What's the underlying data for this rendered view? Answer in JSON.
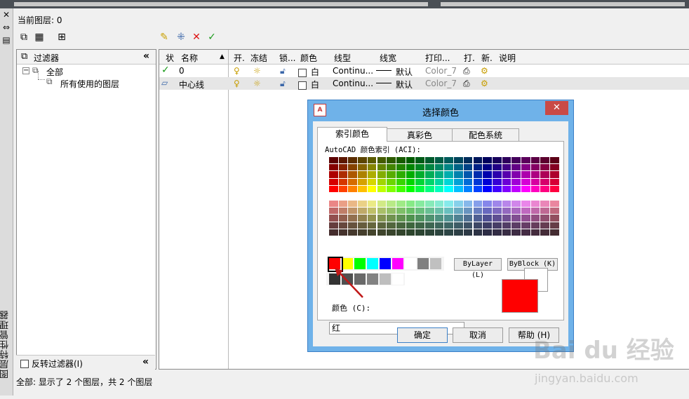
{
  "app": {
    "panel_title_vertical": "图层特性管理器",
    "current_layer": "当前图层: 0"
  },
  "filters": {
    "header": "过滤器",
    "tree": [
      {
        "label": "全部",
        "level": 0
      },
      {
        "label": "所有使用的图层",
        "level": 1
      }
    ],
    "invert_label": "反转过滤器(I)"
  },
  "layers": {
    "columns": [
      "状",
      "名称",
      "开.",
      "冻结",
      "锁...",
      "颜色",
      "线型",
      "线宽",
      "打印...",
      "打.",
      "新.",
      "说明"
    ],
    "rows": [
      {
        "status": "current",
        "name": "0",
        "color": "白",
        "linetype": "Continu...",
        "lineweight": "默认",
        "plotstyle": "Color_7"
      },
      {
        "status": "other",
        "name": "中心线",
        "color": "白",
        "linetype": "Continu...",
        "lineweight": "默认",
        "plotstyle": "Color_7"
      }
    ]
  },
  "status_bar": "全部: 显示了 2 个图层，共 2 个图层",
  "dialog": {
    "title": "选择颜色",
    "tabs": [
      "索引颜色",
      "真彩色",
      "配色系统"
    ],
    "active_tab": 0,
    "aci_label": "AutoCAD 颜色索引 (ACI):",
    "bylayer": "ByLayer (L)",
    "byblock": "ByBlock (K)",
    "color_label": "颜色 (C):",
    "color_value": "红",
    "selected_color": "#ff0000",
    "buttons": {
      "ok": "确定",
      "cancel": "取消",
      "help": "帮助 (H)"
    },
    "standard_colors": [
      "#ff0000",
      "#ffff00",
      "#00ff00",
      "#00ffff",
      "#0000ff",
      "#ff00ff",
      "#ffffff",
      "#808080",
      "#c0c0c0"
    ],
    "gray_shades": [
      "#333333",
      "#505050",
      "#696969",
      "#828282",
      "#bebebe",
      "#ffffff"
    ]
  },
  "watermark": {
    "brand": "Bai du 经验",
    "url": "jingyan.baidu.com"
  }
}
